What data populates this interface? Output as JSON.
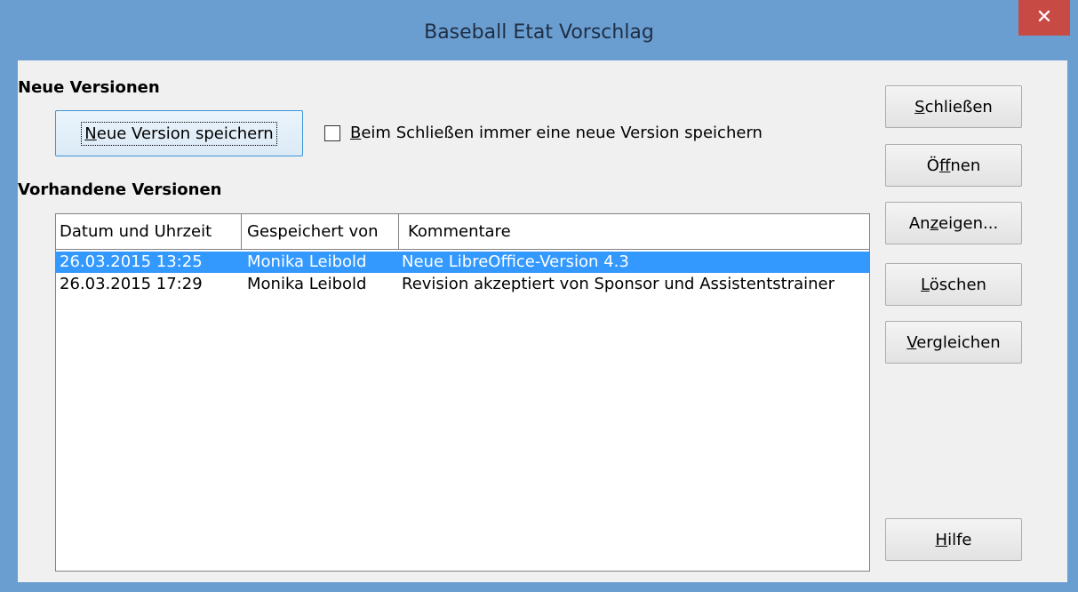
{
  "window": {
    "title": "Baseball Etat Vorschlag",
    "close_label": "✕"
  },
  "new_versions": {
    "heading": "Neue Versionen",
    "save_button": {
      "pre": "",
      "mnemonic": "N",
      "post": "eue Version speichern"
    },
    "always_save_checkbox": {
      "checked": false,
      "pre": "",
      "mnemonic": "B",
      "post": "eim Schließen immer eine neue Version speichern"
    }
  },
  "existing_versions": {
    "heading": "Vorhandene Versionen",
    "columns": [
      "Datum und Uhrzeit",
      "Gespeichert von",
      "Kommentare"
    ],
    "rows": [
      {
        "date": "26.03.2015 13:25",
        "author": "Monika Leibold",
        "comment": "Neue LibreOffice-Version 4.3",
        "selected": true
      },
      {
        "date": "26.03.2015 17:29",
        "author": "Monika Leibold",
        "comment": "Revision akzeptiert von Sponsor und Assistentstrainer",
        "selected": false
      }
    ]
  },
  "side_buttons": {
    "close": {
      "pre": "",
      "mnemonic": "S",
      "post": "chließen"
    },
    "open": {
      "pre": "Ö",
      "mnemonic": "f",
      "post": "fnen"
    },
    "show": {
      "pre": "An",
      "mnemonic": "z",
      "post": "eigen..."
    },
    "delete": {
      "pre": "",
      "mnemonic": "L",
      "post": "öschen"
    },
    "compare": {
      "pre": "",
      "mnemonic": "V",
      "post": "ergleichen"
    },
    "help": {
      "pre": "",
      "mnemonic": "H",
      "post": "ilfe"
    }
  },
  "colors": {
    "title_bar": "#6b9ed0",
    "close_button": "#c74a45",
    "selection": "#3399ff"
  }
}
